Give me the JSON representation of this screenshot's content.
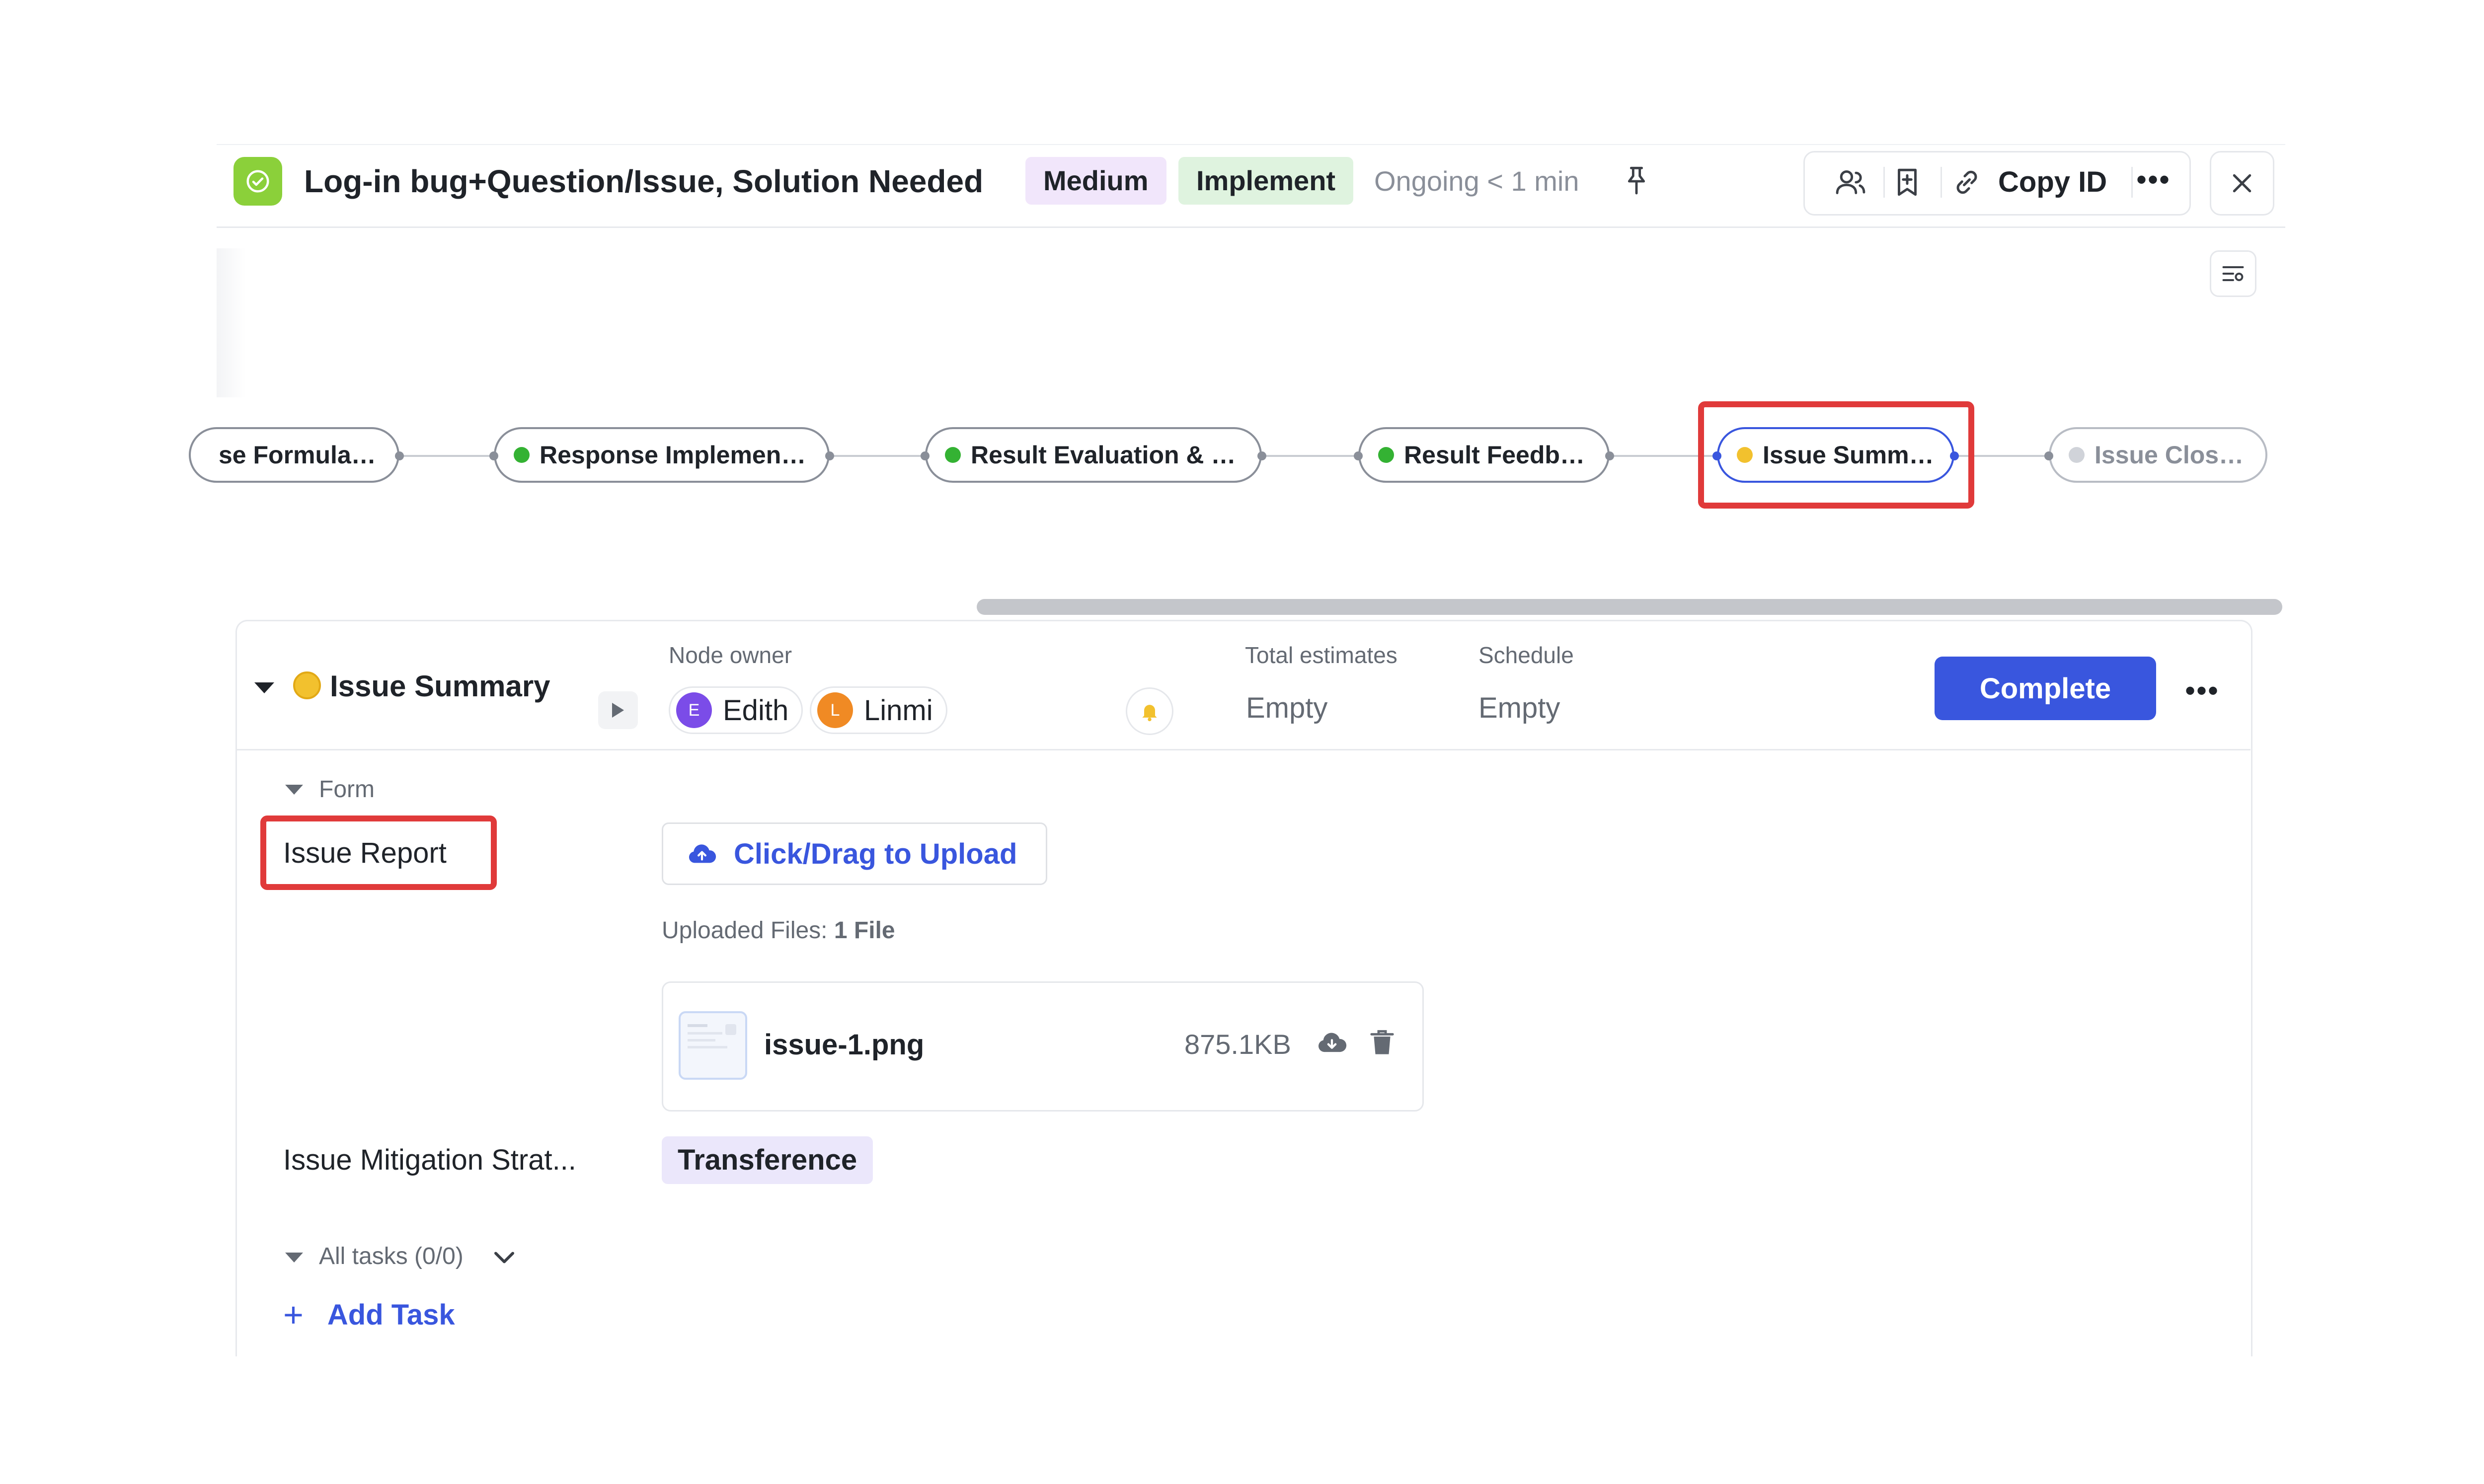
{
  "header": {
    "title": "Log-in bug+Question/Issue, Solution Needed",
    "priority_tag": "Medium",
    "stage_tag": "Implement",
    "status_text": "Ongoing < 1 min",
    "copy_id_label": "Copy ID",
    "icons": [
      "check-circle-icon",
      "pin-icon",
      "members-icon",
      "bookmark-icon",
      "link-icon",
      "more-icon",
      "close-icon",
      "settings-icon"
    ]
  },
  "flow": {
    "nodes": [
      {
        "label": "se Formulation",
        "status": "done"
      },
      {
        "label": "Response Implementat...",
        "status": "done"
      },
      {
        "label": "Result Evaluation & M...",
        "status": "done"
      },
      {
        "label": "Result Feedback",
        "status": "done"
      },
      {
        "label": "Issue Summary",
        "status": "in-progress"
      },
      {
        "label": "Issue Closure",
        "status": "not-started"
      }
    ]
  },
  "node_panel": {
    "title": "Issue Summary",
    "owner_label": "Node owner",
    "owners": [
      {
        "initial": "E",
        "name": "Edith",
        "color": "#7b4ce8"
      },
      {
        "initial": "L",
        "name": "Linmi",
        "color": "#f08a24"
      }
    ],
    "estimates_label": "Total estimates",
    "estimates_value": "Empty",
    "schedule_label": "Schedule",
    "schedule_value": "Empty",
    "complete_button": "Complete",
    "more": "•••"
  },
  "form": {
    "section_label": "Form",
    "issue_report_label": "Issue Report",
    "upload_button": "Click/Drag to Upload",
    "uploaded_prefix": "Uploaded Files:",
    "uploaded_count": "1 File",
    "file": {
      "name": "issue-1.png",
      "size": "875.1KB"
    },
    "mitigation_label": "Issue Mitigation Strat...",
    "mitigation_value": "Transference"
  },
  "tasks": {
    "label": "All tasks (0/0)",
    "add_task": "Add Task"
  },
  "colors": {
    "accent": "#3956de",
    "done": "#34b233",
    "in_progress": "#f2c12e",
    "highlight": "#e03a3a"
  }
}
